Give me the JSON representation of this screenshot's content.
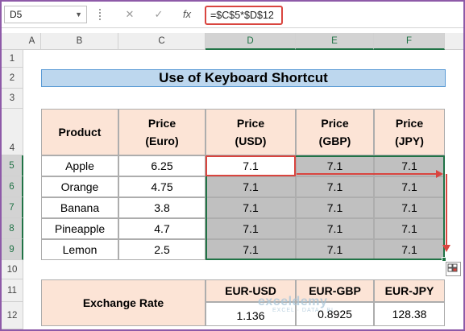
{
  "formula_bar": {
    "name_box": "D5",
    "cancel_glyph": "✕",
    "enter_glyph": "✓",
    "fx_label": "fx",
    "formula": "=$C$5*$D$12"
  },
  "columns": [
    "A",
    "B",
    "C",
    "D",
    "E",
    "F"
  ],
  "rows": [
    "1",
    "2",
    "3",
    "4",
    "5",
    "6",
    "7",
    "8",
    "9",
    "10",
    "11",
    "12"
  ],
  "title": "Use of Keyboard Shortcut",
  "table": {
    "headers": [
      "Product",
      "Price\n(Euro)",
      "Price\n(USD)",
      "Price\n(GBP)",
      "Price\n(JPY)"
    ],
    "rows": [
      {
        "product": "Apple",
        "euro": "6.25",
        "usd": "7.1",
        "gbp": "7.1",
        "jpy": "7.1"
      },
      {
        "product": "Orange",
        "euro": "4.75",
        "usd": "7.1",
        "gbp": "7.1",
        "jpy": "7.1"
      },
      {
        "product": "Banana",
        "euro": "3.8",
        "usd": "7.1",
        "gbp": "7.1",
        "jpy": "7.1"
      },
      {
        "product": "Pineapple",
        "euro": "4.7",
        "usd": "7.1",
        "gbp": "7.1",
        "jpy": "7.1"
      },
      {
        "product": "Lemon",
        "euro": "2.5",
        "usd": "7.1",
        "gbp": "7.1",
        "jpy": "7.1"
      }
    ]
  },
  "exchange": {
    "label": "Exchange Rate",
    "headers": [
      "EUR-USD",
      "EUR-GBP",
      "EUR-JPY"
    ],
    "values": [
      "1.136",
      "0.8925",
      "128.38"
    ]
  },
  "watermark": {
    "name": "exceldemy",
    "tagline": "EXCEL · DATA · BI"
  },
  "colors": {
    "header_fill": "#fce4d6",
    "title_fill": "#bdd7ee",
    "selection_fill": "#c0c0c0",
    "selection_border": "#217346",
    "annotation_red": "#d9453f"
  }
}
